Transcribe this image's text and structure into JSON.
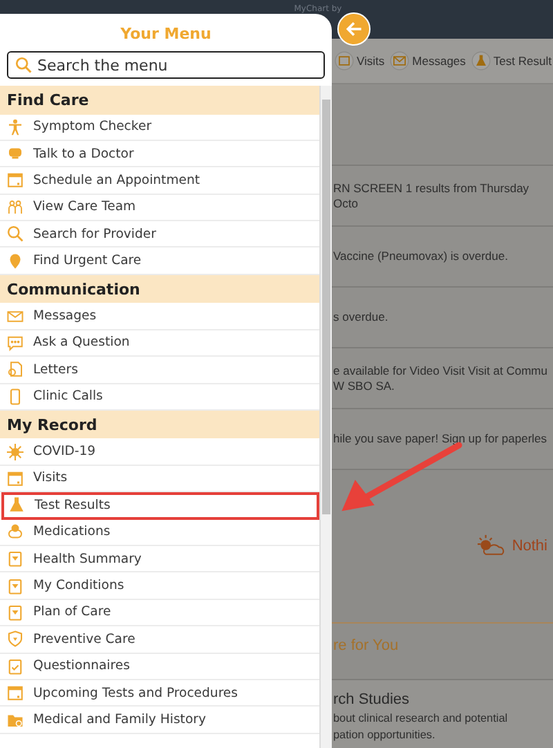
{
  "top_bar": {
    "title": "MyChart by"
  },
  "page": {
    "nav": [
      {
        "label": "Visits",
        "kind": "calendar"
      },
      {
        "label": "Messages",
        "kind": "envelope"
      },
      {
        "label": "Test Result",
        "kind": "flask"
      }
    ],
    "notices": [
      {
        "lines": [
          "RN SCREEN 1 results from Thursday Octo"
        ]
      },
      {
        "lines": [
          "Vaccine (Pneumovax) is overdue."
        ]
      },
      {
        "lines": [
          "s overdue."
        ]
      },
      {
        "lines": [
          "e available for Video Visit Visit at Commu",
          "W SBO SA."
        ]
      },
      {
        "lines": [
          "hile you save paper! Sign up for paperles"
        ]
      }
    ],
    "weather_text": "Nothi",
    "section_title": "re for You",
    "card": {
      "title": "rch Studies",
      "lines": [
        "bout clinical research and potential",
        "pation opportunities."
      ]
    }
  },
  "menu": {
    "title": "Your Menu",
    "search": {
      "placeholder": "Search the menu"
    },
    "sections": [
      {
        "title": "Find Care",
        "items": [
          {
            "label": "Symptom Checker",
            "kind": "person",
            "highlighted": false
          },
          {
            "label": "Talk to a Doctor",
            "kind": "monitor",
            "highlighted": false
          },
          {
            "label": "Schedule an Appointment",
            "kind": "calendar",
            "highlighted": false
          },
          {
            "label": "View Care Team",
            "kind": "team",
            "highlighted": false
          },
          {
            "label": "Search for Provider",
            "kind": "search",
            "highlighted": false
          },
          {
            "label": "Find Urgent Care",
            "kind": "pin",
            "highlighted": false
          }
        ]
      },
      {
        "title": "Communication",
        "items": [
          {
            "label": "Messages",
            "kind": "envelope",
            "highlighted": false
          },
          {
            "label": "Ask a Question",
            "kind": "chat",
            "highlighted": false
          },
          {
            "label": "Letters",
            "kind": "letter",
            "highlighted": false
          },
          {
            "label": "Clinic Calls",
            "kind": "phone",
            "highlighted": false
          }
        ]
      },
      {
        "title": "My Record",
        "items": [
          {
            "label": "COVID-19",
            "kind": "virus",
            "highlighted": false
          },
          {
            "label": "Visits",
            "kind": "calendar",
            "highlighted": false
          },
          {
            "label": "Test Results",
            "kind": "flask",
            "highlighted": true
          },
          {
            "label": "Medications",
            "kind": "pills",
            "highlighted": false
          },
          {
            "label": "Health Summary",
            "kind": "clipboard",
            "highlighted": false
          },
          {
            "label": "My Conditions",
            "kind": "clipboard",
            "highlighted": false
          },
          {
            "label": "Plan of Care",
            "kind": "clipboard",
            "highlighted": false
          },
          {
            "label": "Preventive Care",
            "kind": "shield",
            "highlighted": false
          },
          {
            "label": "Questionnaires",
            "kind": "checklist",
            "highlighted": false
          },
          {
            "label": "Upcoming Tests and Procedures",
            "kind": "calendar",
            "highlighted": false
          },
          {
            "label": "Medical and Family History",
            "kind": "folder",
            "highlighted": false
          }
        ]
      }
    ]
  }
}
